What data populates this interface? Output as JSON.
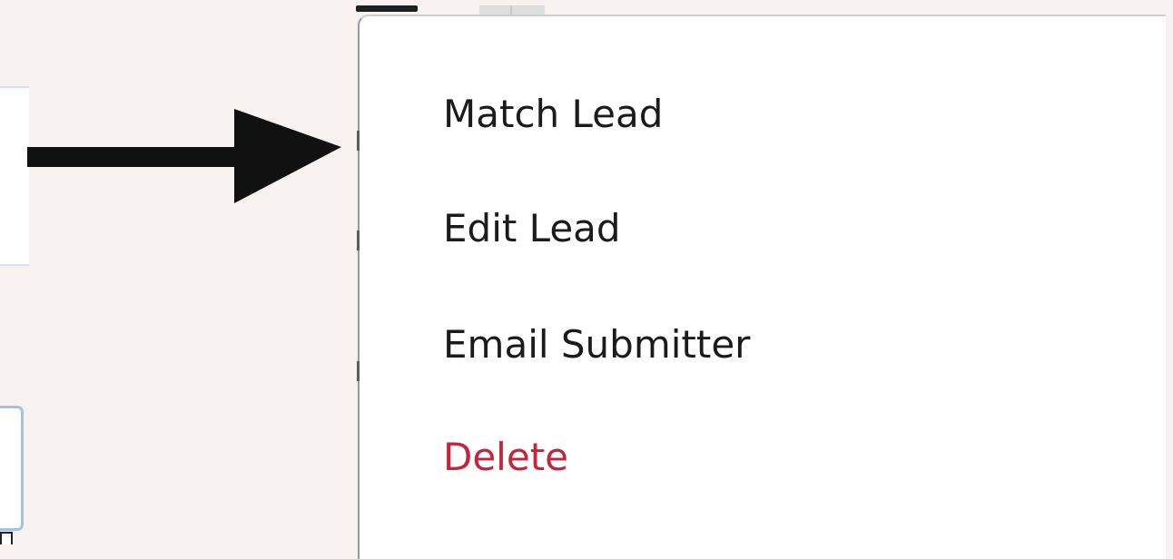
{
  "context_menu": {
    "items": [
      {
        "label": "Match Lead",
        "danger": false
      },
      {
        "label": "Edit Lead",
        "danger": false
      },
      {
        "label": "Email Submitter",
        "danger": false
      },
      {
        "label": "Delete",
        "danger": true
      }
    ]
  },
  "colors": {
    "menu_background": "#ffffff",
    "page_background": "#f7f1ef",
    "item_text": "#1b1b1b",
    "delete_text": "#c4253c",
    "field_border": "#9fc3e8",
    "arrow": "#111111"
  },
  "icons": {
    "pointer": "right-arrow-icon"
  }
}
